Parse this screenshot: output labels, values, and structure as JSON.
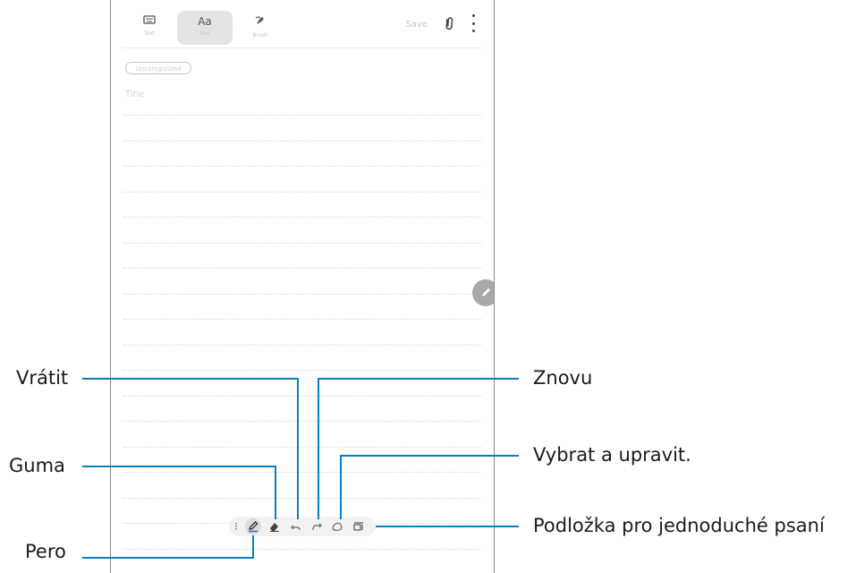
{
  "colors": {
    "leader": "#0b7fbd",
    "frame": "#8a8a8a",
    "fab": "#a9a9a9"
  },
  "note_app": {
    "tabs": [
      {
        "icon": "keyboard-icon",
        "label": "Text",
        "glyph": "▤"
      },
      {
        "icon": "handwriting-text-icon",
        "label": "Text",
        "glyph": "Aa"
      },
      {
        "icon": "brush-icon",
        "label": "Brush",
        "glyph": "✎"
      }
    ],
    "save_label": "Save",
    "category_placeholder": "Uncategorized",
    "title_placeholder": "Title"
  },
  "toolbar": {
    "tools": [
      "pen-icon",
      "eraser-icon",
      "undo-icon",
      "redo-icon",
      "selection-icon",
      "easy-writing-pad-icon"
    ]
  },
  "callouts": {
    "undo": "Vrátit",
    "redo": "Znovu",
    "eraser": "Guma",
    "selection": "Vybrat a upravit.",
    "pen": "Pero",
    "easy_writing_pad": "Podložka pro jednoduché psaní"
  }
}
